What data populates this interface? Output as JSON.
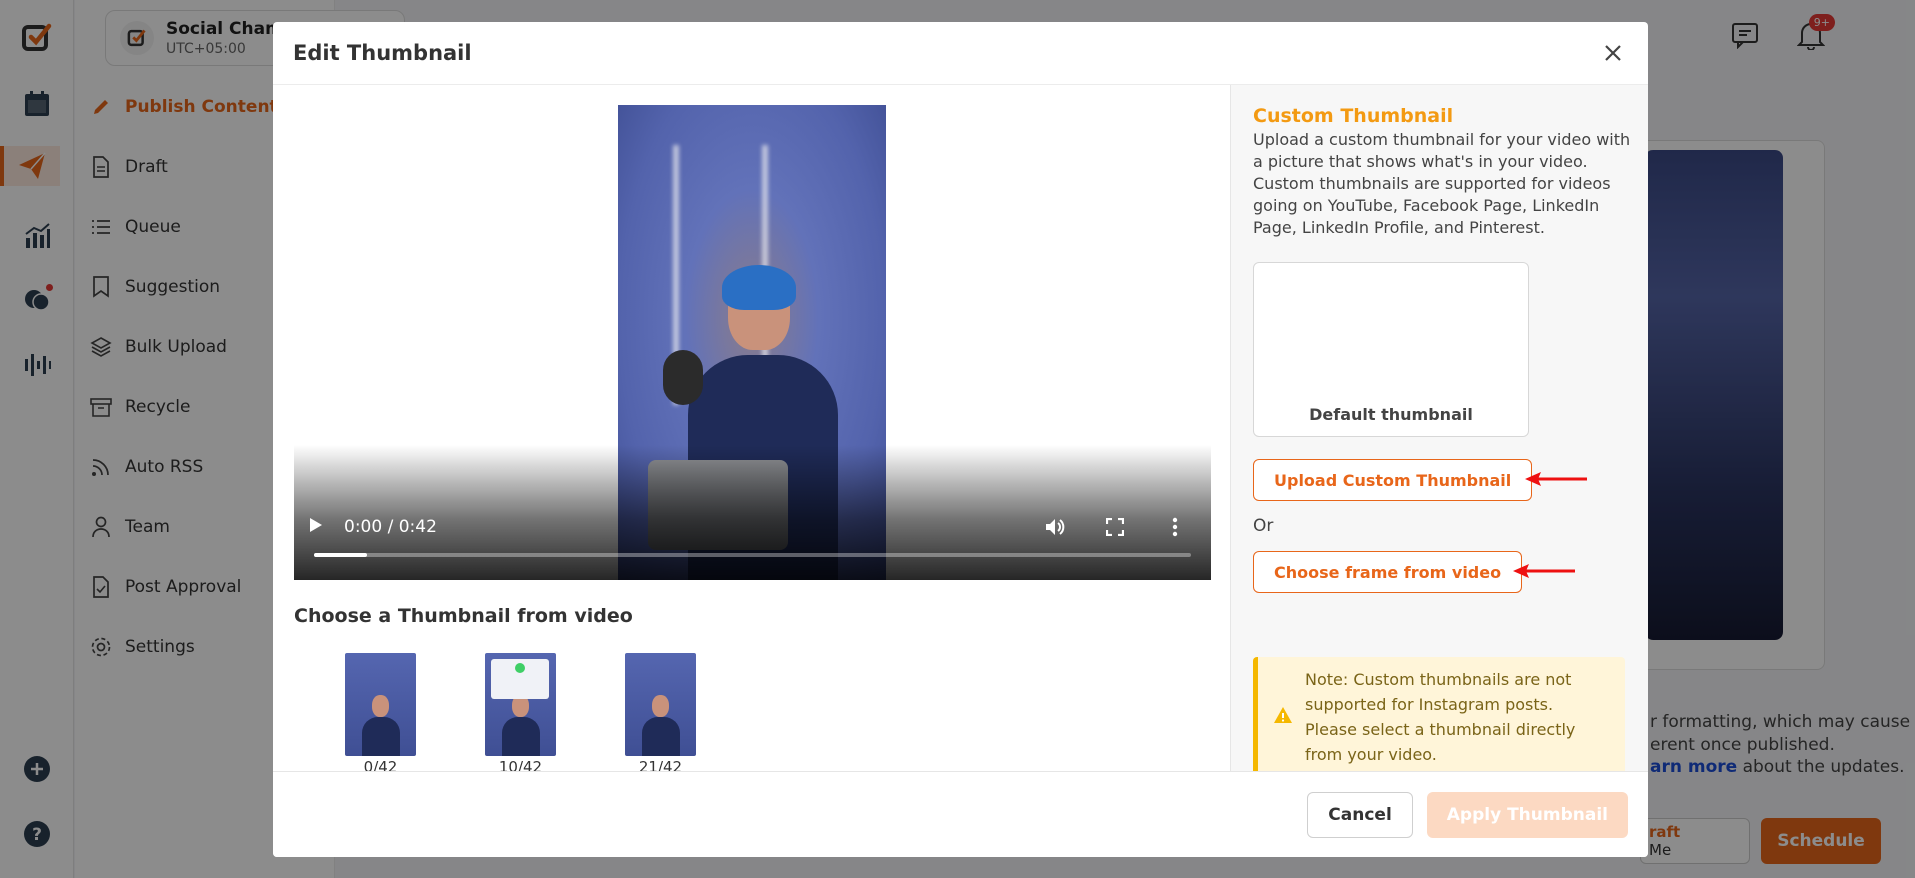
{
  "app": {
    "workspace_name": "Social Champ",
    "workspace_tz": "UTC+05:00",
    "notification_count": "9+"
  },
  "sidebar": {
    "items": [
      {
        "label": "Publish Content",
        "icon": "pen-icon"
      },
      {
        "label": "Draft",
        "icon": "document-icon"
      },
      {
        "label": "Queue",
        "icon": "list-icon"
      },
      {
        "label": "Suggestion",
        "icon": "bookmark-icon"
      },
      {
        "label": "Bulk Upload",
        "icon": "layers-icon"
      },
      {
        "label": "Recycle",
        "icon": "archive-icon"
      },
      {
        "label": "Auto RSS",
        "icon": "rss-icon"
      },
      {
        "label": "Team",
        "icon": "user-icon"
      },
      {
        "label": "Post Approval",
        "icon": "approval-icon"
      },
      {
        "label": "Settings",
        "icon": "gear-icon"
      }
    ]
  },
  "background": {
    "text_line1": "r formatting, which may cause",
    "text_line2": "erent once published.",
    "text_link": "arn more",
    "text_line3_rest": " about the updates.",
    "draft_label": "raft",
    "draft_sub": "Me",
    "schedule_label": "Schedule"
  },
  "modal": {
    "title": "Edit Thumbnail",
    "video": {
      "time": "0:00 / 0:42",
      "progress": 0.06
    },
    "choose_title": "Choose a Thumbnail from video",
    "thumbnails": [
      {
        "label": "0/42"
      },
      {
        "label": "10/42"
      },
      {
        "label": "21/42"
      }
    ],
    "custom": {
      "title": "Custom Thumbnail",
      "description": "Upload a custom thumbnail for your video with a picture that shows what's in your video. Custom thumbnails are supported for videos going on YouTube, Facebook Page, LinkedIn Page, LinkedIn Profile, and Pinterest.",
      "default_thumb_label": "Default thumbnail",
      "upload_btn": "Upload Custom Thumbnail",
      "or_text": "Or",
      "choose_frame_btn": "Choose frame from video",
      "note": "Note: Custom thumbnails are not supported for Instagram posts. Please select a thumbnail directly from your video."
    },
    "footer": {
      "cancel": "Cancel",
      "apply": "Apply Thumbnail"
    }
  },
  "colors": {
    "brand": "#e8661a",
    "custom_title": "#f39a12",
    "note_bg": "#fff5d9",
    "note_border": "#f5b800"
  }
}
